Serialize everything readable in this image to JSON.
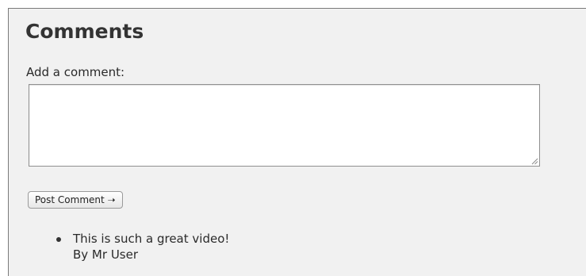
{
  "comments_section": {
    "title": "Comments",
    "form": {
      "label": "Add a comment:",
      "textarea_value": "",
      "post_button_label": "Post Comment ➝"
    },
    "comments": [
      {
        "text": "This is such a great video!",
        "author": "By Mr User"
      }
    ]
  }
}
